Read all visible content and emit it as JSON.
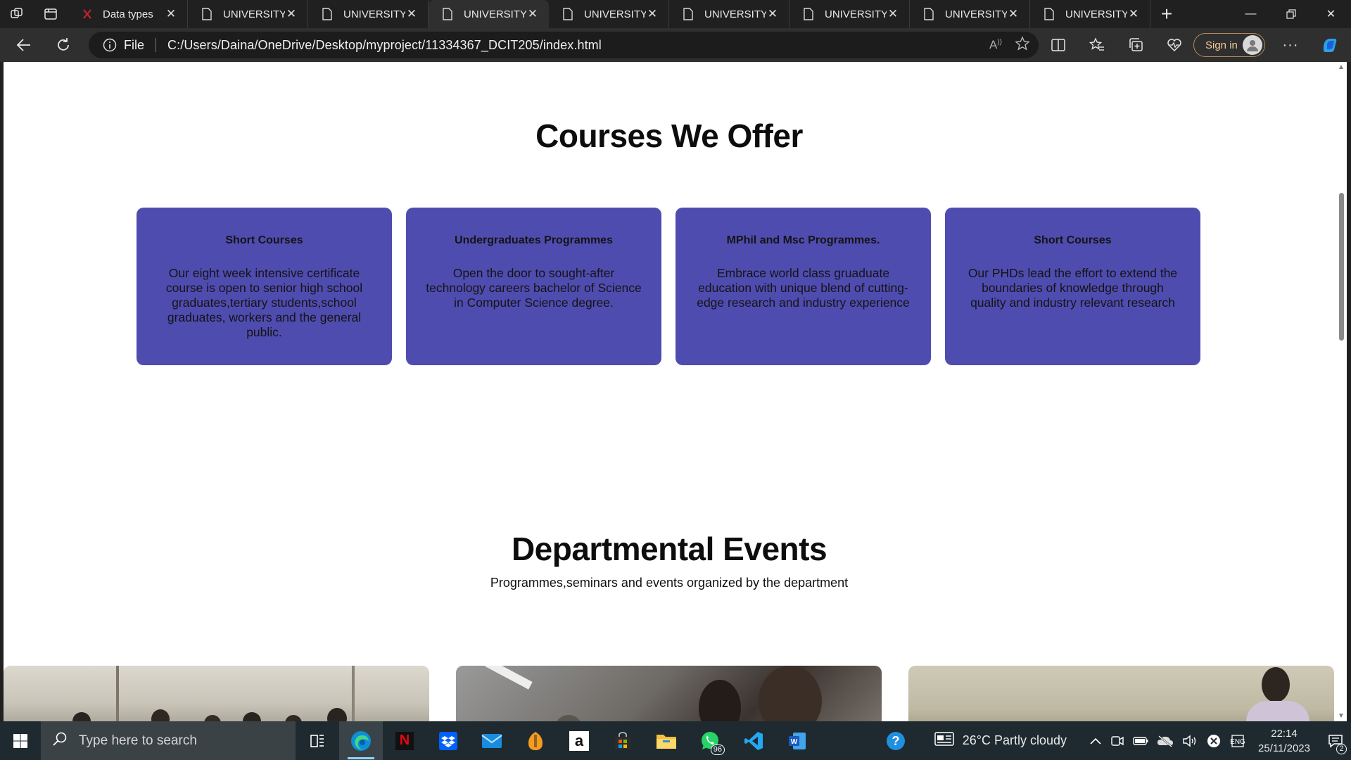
{
  "browser": {
    "tabs": [
      {
        "title": "Data types",
        "active": false,
        "favicon": "red-x-icon"
      },
      {
        "title": "UNIVERSITY OF GHANA",
        "active": false,
        "favicon": "page-icon"
      },
      {
        "title": "UNIVERSITY OF GHANA",
        "active": false,
        "favicon": "page-icon"
      },
      {
        "title": "UNIVERSITY OF GHANA",
        "active": true,
        "favicon": "page-icon"
      },
      {
        "title": "UNIVERSITY OF GHANA",
        "active": false,
        "favicon": "page-icon"
      },
      {
        "title": "UNIVERSITY OF GHANA",
        "active": false,
        "favicon": "page-icon"
      },
      {
        "title": "UNIVERSITY OF GHANA",
        "active": false,
        "favicon": "page-icon"
      },
      {
        "title": "UNIVERSITY OF GHANA",
        "active": false,
        "favicon": "page-icon"
      },
      {
        "title": "UNIVERSITY OF GHANA",
        "active": false,
        "favicon": "page-icon"
      }
    ],
    "address": {
      "scheme_label": "File",
      "url": "C:/Users/Daina/OneDrive/Desktop/myproject/11334367_DCIT205/index.html"
    },
    "signin_label": "Sign in",
    "colors": {
      "chrome": "#202020",
      "toolbar": "#2f2f2f",
      "signin_accent": "#f4c89a"
    }
  },
  "page": {
    "courses": {
      "heading": "Courses We Offer",
      "cards": [
        {
          "title": "Short Courses",
          "text": "Our eight week intensive certificate course is open to senior high school graduates,tertiary students,school graduates, workers and the general public."
        },
        {
          "title": "Undergraduates Programmes",
          "text": "Open the door to sought-after technology careers bachelor of Science in Computer Science degree."
        },
        {
          "title": "MPhil and Msc Programmes.",
          "text": "Embrace world class gruaduate education with unique blend of cutting-edge research and industry experience"
        },
        {
          "title": "Short Courses",
          "text": "Our PHDs lead the effort to extend the boundaries of knowledge through quality and industry relevant research"
        }
      ],
      "card_color": "#4f4cb0"
    },
    "events": {
      "heading": "Departmental Events",
      "subtitle": "Programmes,seminars and events organized by the department"
    }
  },
  "taskbar": {
    "search_placeholder": "Type here to search",
    "apps": [
      "task-view-icon",
      "edge-icon",
      "netflix-icon",
      "dropbox-icon",
      "mail-icon",
      "fl-studio-icon",
      "amazon-icon",
      "store-icon",
      "file-explorer-icon",
      "whatsapp-icon",
      "vscode-icon",
      "word-icon"
    ],
    "whatsapp_badge": "96",
    "weather": "26°C  Partly cloudy",
    "time": "22:14",
    "date": "25/11/2023",
    "notifications": "2"
  }
}
